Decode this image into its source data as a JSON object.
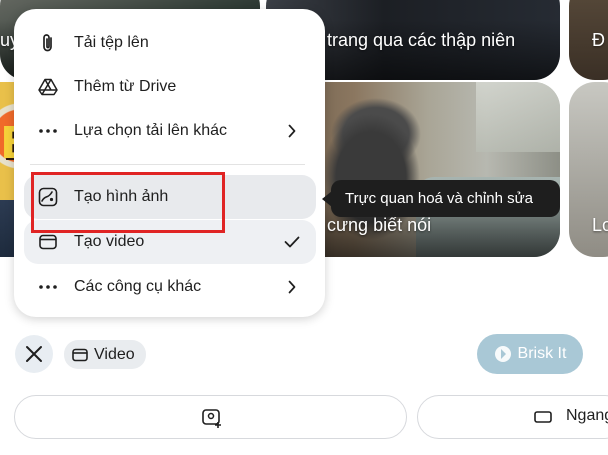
{
  "background_cards": {
    "top_left_caption": "uy",
    "top_mid_caption": "trang qua các thập niên",
    "top_right_caption": "Đ",
    "dog_caption": "cưng biết nói",
    "right2_caption": "Lo",
    "comic_letter": "B"
  },
  "menu": {
    "items": [
      {
        "label": "Tải tệp lên",
        "icon": "paperclip-icon"
      },
      {
        "label": "Thêm từ Drive",
        "icon": "drive-icon"
      },
      {
        "label": "Lựa chọn tải lên khác",
        "icon": "more-dots-icon",
        "trail": "chevron-right-icon"
      },
      {
        "label": "Tạo hình ảnh",
        "icon": "image-create-icon",
        "state": "hovered"
      },
      {
        "label": "Tạo video",
        "icon": "video-icon",
        "trail": "check-icon",
        "state": "selected"
      },
      {
        "label": "Các công cụ khác",
        "icon": "more-dots-icon",
        "trail": "chevron-right-icon"
      }
    ]
  },
  "tooltip": {
    "text": "Trực quan hoá và chỉnh sửa"
  },
  "composer": {
    "close_icon": "close-icon",
    "chip_label": "Video",
    "brisk_label": "Brisk It",
    "aspect_label": "Ngang"
  },
  "colors": {
    "highlight": "#e02424",
    "brisk": "#a9c8d6",
    "tooltip_bg": "#1e1e1e"
  }
}
